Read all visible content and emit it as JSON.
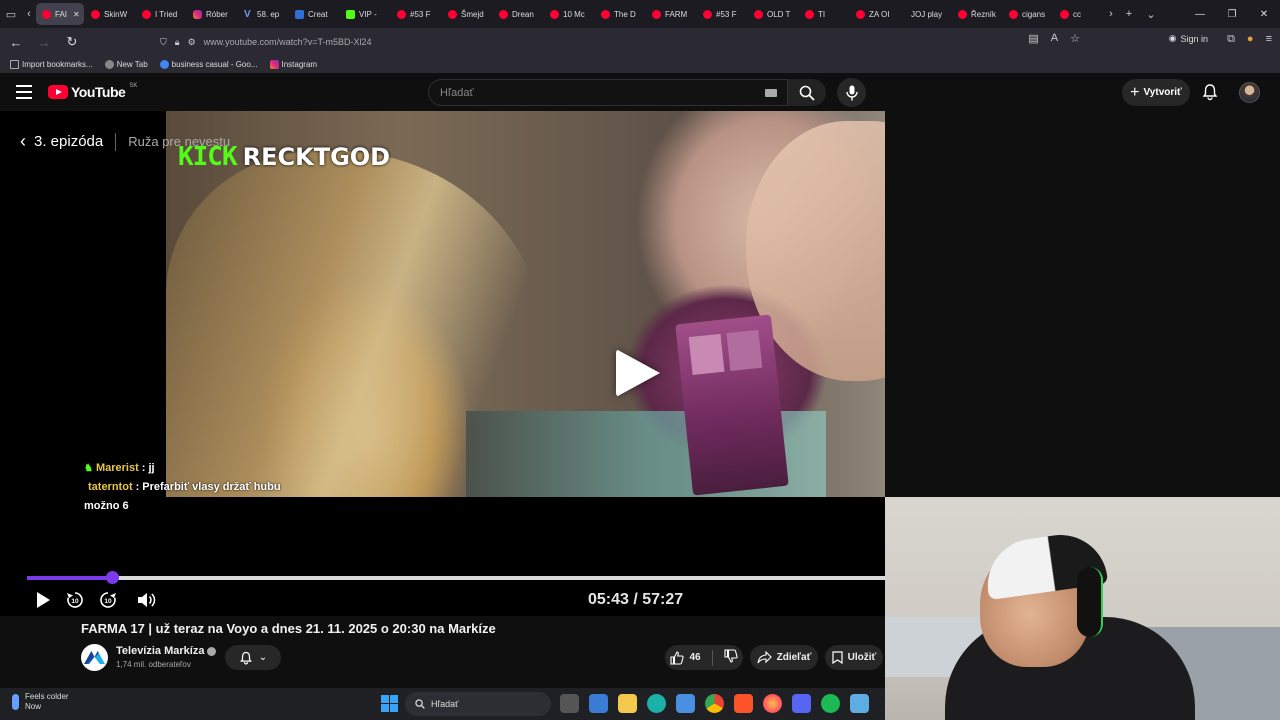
{
  "browser": {
    "tabs": [
      {
        "label": "FAI",
        "icon": "youtube-icon"
      },
      {
        "label": "SkinW",
        "icon": "youtube-icon"
      },
      {
        "label": "I Tried",
        "icon": "youtube-icon"
      },
      {
        "label": "Róber",
        "icon": "instagram-icon"
      },
      {
        "label": "58. ep",
        "icon": "vimeo-icon"
      },
      {
        "label": "Creat",
        "icon": "page-icon"
      },
      {
        "label": "VIP -",
        "icon": "kick-icon"
      },
      {
        "label": "#53 F",
        "icon": "youtube-icon"
      },
      {
        "label": "Šmejd",
        "icon": "youtube-icon"
      },
      {
        "label": "Drean",
        "icon": "youtube-icon"
      },
      {
        "label": "10 Mc",
        "icon": "youtube-icon"
      },
      {
        "label": "The D",
        "icon": "youtube-icon"
      },
      {
        "label": "FARM",
        "icon": "youtube-icon"
      },
      {
        "label": "#53 F",
        "icon": "youtube-icon"
      },
      {
        "label": "OLD T",
        "icon": "youtube-icon"
      },
      {
        "label": "TI",
        "icon": "youtube-icon"
      },
      {
        "label": "ZA OI",
        "icon": "youtube-icon"
      },
      {
        "label": "JOJ play",
        "icon": "joj-icon"
      },
      {
        "label": "Řezník",
        "icon": "youtube-icon"
      },
      {
        "label": "cigans",
        "icon": "youtube-icon"
      },
      {
        "label": "cc",
        "icon": "youtube-icon"
      }
    ],
    "url": "www.youtube.com/watch?v=T-m5BD-Xl24",
    "sign_in": "Sign in",
    "bookmarks": [
      {
        "label": "Import bookmarks...",
        "icon": "import-icon"
      },
      {
        "label": "New Tab",
        "icon": "globe-icon"
      },
      {
        "label": "business casual - Goo...",
        "icon": "google-icon"
      },
      {
        "label": "Instagram",
        "icon": "instagram-icon"
      }
    ]
  },
  "youtube": {
    "logo_text": "YouTube",
    "region": "SK",
    "search_placeholder": "Hľadať",
    "create_label": "Vytvoriť"
  },
  "player": {
    "episode_label": "3. epizóda",
    "episode_title": "Ruža pre nevestu",
    "kick_logo": "KICK",
    "streamer_name": "RECKTGOD",
    "chat": [
      {
        "user": "Marerist",
        "message": "jj"
      },
      {
        "user": "taterntot",
        "message": "Prefarbiť vlasy držať hubu"
      },
      {
        "user": "",
        "message": "možno 6"
      }
    ],
    "current_time": "05:43",
    "duration": "57:27",
    "time_display": "05:43 / 57:27",
    "progress_fraction": 0.0995,
    "accent_color": "#7c3aed"
  },
  "video": {
    "title": "FARMA 17 | už teraz na Voyo a dnes 21. 11. 2025 o 20:30 na Markíze",
    "channel_name": "Televízia Markíza",
    "subscribers": "1,74 mil. odberateľov",
    "likes": "46",
    "share_label": "Zdieľať",
    "save_label": "Uložiť"
  },
  "taskbar": {
    "weather_title": "Feels colder",
    "weather_sub": "Now",
    "search_placeholder": "Hľadať"
  }
}
